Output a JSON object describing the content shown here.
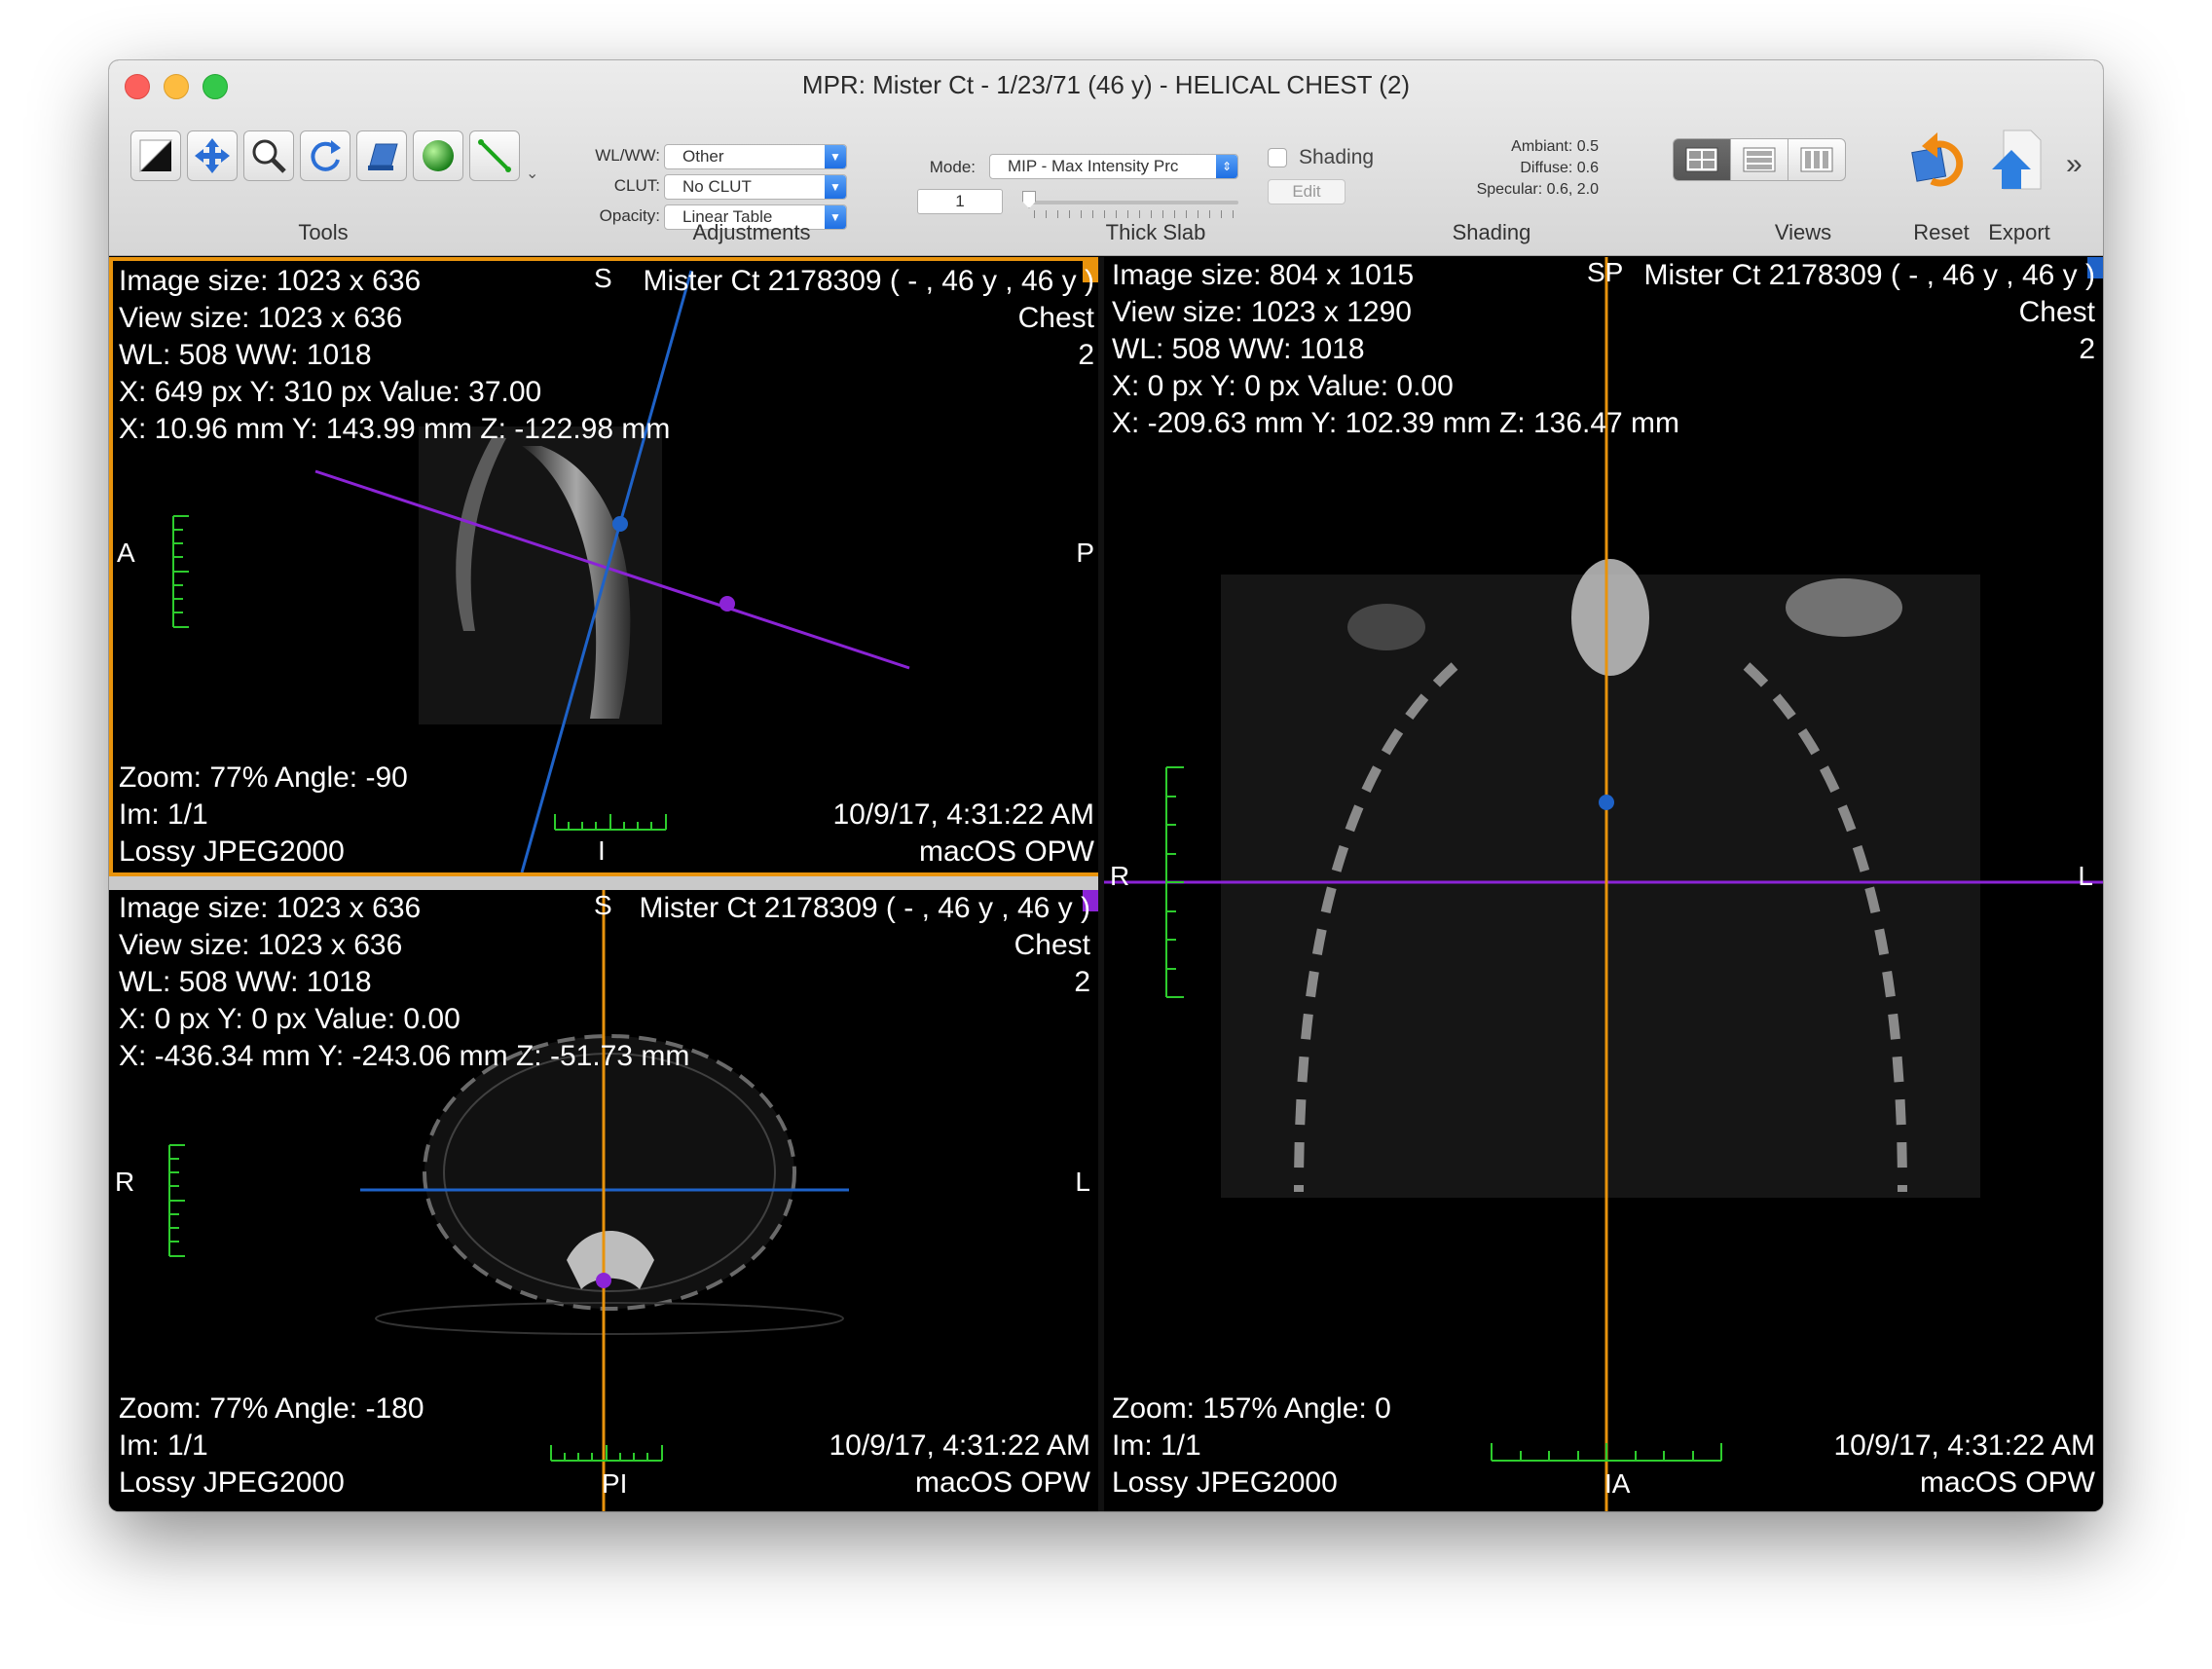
{
  "window": {
    "title": "MPR: Mister Ct - 1/23/71 (46 y) - HELICAL CHEST (2)"
  },
  "toolbar": {
    "groups": {
      "tools": "Tools",
      "adjustments": "Adjustments",
      "thick_slab": "Thick Slab",
      "shading": "Shading",
      "views": "Views",
      "reset": "Reset",
      "export": "Export"
    },
    "tools": [
      "contrast-tool",
      "move-tool",
      "zoom-tool",
      "rotate-tool",
      "layers-tool",
      "sphere-tool",
      "measure-tool"
    ],
    "adjustments": {
      "wlww_label": "WL/WW:",
      "wlww_value": "Other",
      "clut_label": "CLUT:",
      "clut_value": "No CLUT",
      "opacity_label": "Opacity:",
      "opacity_value": "Linear Table"
    },
    "thick_slab": {
      "mode_label": "Mode:",
      "mode_value": "MIP - Max Intensity Prc",
      "slab_value": "1"
    },
    "shading": {
      "checkbox_label": "Shading",
      "checked": false,
      "edit_label": "Edit",
      "ambiant": "Ambiant: 0.5",
      "diffuse": "Diffuse: 0.6",
      "specular": "Specular: 0.6, 2.0"
    },
    "overflow": "»"
  },
  "colors": {
    "selected_border": "#e8930c",
    "sagittal_marker": "#e8930c",
    "coronal_line": "#1e62c8",
    "axial_line": "#8b23d6",
    "scale": "#2dcc2d"
  },
  "panes": {
    "sagittal": {
      "image_size": "Image size: 1023 x 636",
      "view_size": "View size: 1023 x 636",
      "wlww": "WL: 508 WW: 1018",
      "px_value": "X: 649 px Y: 310 px Value: 37.00",
      "mm_value": "X: 10.96 mm Y: 143.99 mm Z: -122.98 mm",
      "patient": "Mister Ct 2178309 (  - ,  46 y ,  46 y )",
      "region": "Chest",
      "series": "2",
      "orient_left": "A",
      "orient_right": "P",
      "orient_top": "S",
      "orient_bottom": "I",
      "zoom": "Zoom: 77% Angle: -90",
      "im": "Im: 1/1",
      "compression": "Lossy JPEG2000",
      "datetime": "10/9/17, 4:31:22 AM",
      "institution": "macOS OPW"
    },
    "axial": {
      "image_size": "Image size: 1023 x 636",
      "view_size": "View size: 1023 x 636",
      "wlww": "WL: 508 WW: 1018",
      "px_value": "X: 0 px Y: 0 px Value: 0.00",
      "mm_value": "X: -436.34 mm Y: -243.06 mm Z: -51.73 mm",
      "patient": "Mister Ct 2178309 (  - ,  46 y ,  46 y )",
      "region": "Chest",
      "series": "2",
      "orient_left": "R",
      "orient_right": "L",
      "orient_top": "S",
      "orient_bottom": "PI",
      "zoom": "Zoom: 77% Angle: -180",
      "im": "Im: 1/1",
      "compression": "Lossy JPEG2000",
      "datetime": "10/9/17, 4:31:22 AM",
      "institution": "macOS OPW"
    },
    "coronal": {
      "image_size": "Image size: 804 x 1015",
      "view_size": "View size: 1023 x 1290",
      "wlww": "WL: 508 WW: 1018",
      "px_value": "X: 0 px Y: 0 px Value: 0.00",
      "mm_value": "X: -209.63 mm Y: 102.39 mm Z: 136.47 mm",
      "patient": "Mister Ct 2178309 (  - ,  46 y ,  46 y )",
      "region": "Chest",
      "series": "2",
      "orient_left": "R",
      "orient_right": "L",
      "orient_top": "SP",
      "orient_bottom": "IA",
      "zoom": "Zoom: 157% Angle: 0",
      "im": "Im: 1/1",
      "compression": "Lossy JPEG2000",
      "datetime": "10/9/17, 4:31:22 AM",
      "institution": "macOS OPW"
    }
  }
}
